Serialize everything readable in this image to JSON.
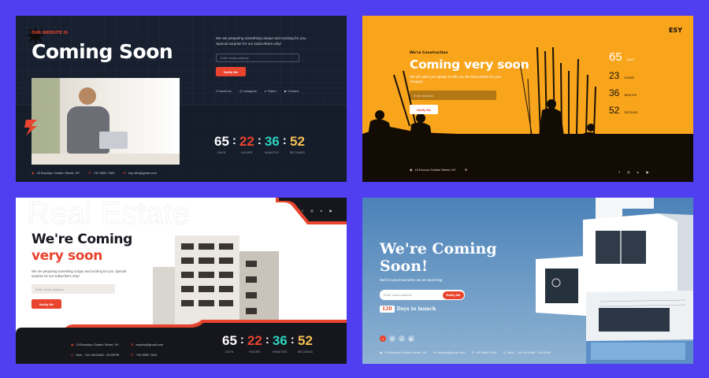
{
  "colors": {
    "background": "#4f3ff0",
    "accent": "#e8442e",
    "teal": "#2dd4bf",
    "gold": "#f4c152",
    "orange": "#f9a51c"
  },
  "card1": {
    "badge": "OUR WEBSITE IS",
    "title": "Coming Soon",
    "desc": "We are preparing something unique and exciting for you. Special surprise for our subscribers only!",
    "email_placeholder": "Enter email address",
    "notify": "Notify Me",
    "socials": [
      "Facebook",
      "Instagram",
      "Twitter",
      "Youtube"
    ],
    "countdown": [
      {
        "value": "65",
        "label": "DAYS"
      },
      {
        "value": "22",
        "label": "HOURS"
      },
      {
        "value": "36",
        "label": "MINUTES"
      },
      {
        "value": "52",
        "label": "SECONDS"
      }
    ],
    "address": "15 Brooklyn Golden Street, NY",
    "phone": "+00 9800 7604",
    "email": "esy info@gmail.com"
  },
  "card2": {
    "logo": "ESY",
    "kicker": "We're Construction",
    "title": "Coming very soon",
    "desc": "We will notice you update to offer you the best website for your company",
    "email_placeholder": "Enter Address",
    "notify": "Notify Me",
    "countdown": [
      {
        "value": "65",
        "label": "DAYS"
      },
      {
        "value": "23",
        "label": "HOURS"
      },
      {
        "value": "36",
        "label": "MINUTES"
      },
      {
        "value": "52",
        "label": "SECONDS"
      }
    ],
    "address": "15 Dronun Golden Street, NY",
    "footer_note": "",
    "socials": [
      "f",
      "ig",
      "tw",
      "yt"
    ]
  },
  "card3": {
    "watermark": "Real Estate",
    "title_line1": "We're Coming",
    "title_line2": "very soon",
    "desc": "We are preparing something unique and exciting for you. Special surprise for our subscribers only!",
    "email_placeholder": "Enter email address",
    "notify": "Notify Me",
    "address": "15 Brooklyn Golden Street, NY",
    "email": "esyinfo@gmail.com",
    "hours": "Mon - Tue 08:00AM - 05:00PM",
    "phone": "+00 9800 7604",
    "countdown": [
      {
        "value": "65",
        "label": "DAYS"
      },
      {
        "value": "22",
        "label": "HOURS"
      },
      {
        "value": "36",
        "label": "MINUTES"
      },
      {
        "value": "52",
        "label": "SECONDS"
      }
    ],
    "socials": [
      "f",
      "ig",
      "tw",
      "yt"
    ]
  },
  "card4": {
    "title_line1": "We're Coming",
    "title_line2": "Soon!",
    "desc": "We'll let you know when we are launching",
    "email_placeholder": "Enter email address",
    "notify": "Notify Me",
    "days_number": "120",
    "days_text": "Days to launch",
    "socials": [
      "f",
      "ig",
      "tw",
      "yt"
    ],
    "address": "15 Brooklyn Golden Street, NY",
    "email": "esyinfo@gmail.com",
    "phone": "+00 9800 7604",
    "hours": "Mon - Tue 08:00AM - 05:00PM"
  }
}
